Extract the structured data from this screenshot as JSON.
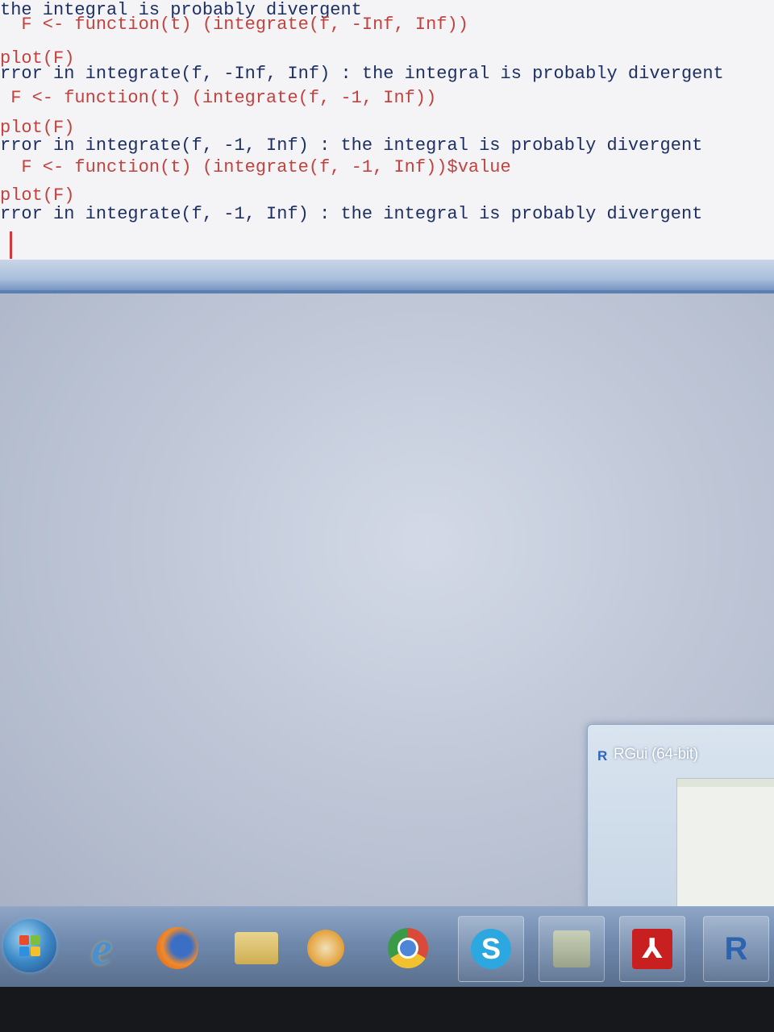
{
  "console": {
    "lines": [
      {
        "type": "output",
        "text": "the integral is probably divergent"
      },
      {
        "type": "command",
        "text": "  F <- function(t) (integrate(f, -Inf, Inf))"
      },
      {
        "type": "command",
        "text": "plot(F)"
      },
      {
        "type": "output",
        "text": "rror in integrate(f, -Inf, Inf) : the integral is probably divergent"
      },
      {
        "type": "command",
        "text": " F <- function(t) (integrate(f, -1, Inf))"
      },
      {
        "type": "command",
        "text": "plot(F)"
      },
      {
        "type": "output",
        "text": "rror in integrate(f, -1, Inf) : the integral is probably divergent"
      },
      {
        "type": "command",
        "text": "  F <- function(t) (integrate(f, -1, Inf))$value"
      },
      {
        "type": "command",
        "text": "plot(F)"
      },
      {
        "type": "output",
        "text": "rror in integrate(f, -1, Inf) : the integral is probably divergent"
      }
    ]
  },
  "taskbar": {
    "preview": {
      "title": "RGui (64-bit)",
      "icon_letter": "R"
    },
    "items": [
      {
        "name": "start-button",
        "icon": "windows-flag-icon"
      },
      {
        "name": "internet-explorer",
        "icon": "internet-explorer-icon",
        "glyph": "e"
      },
      {
        "name": "firefox",
        "icon": "firefox-icon"
      },
      {
        "name": "file-explorer",
        "icon": "folder-icon"
      },
      {
        "name": "media-player",
        "icon": "media-player-icon"
      },
      {
        "name": "chrome",
        "icon": "chrome-icon"
      },
      {
        "name": "skype",
        "icon": "skype-icon",
        "glyph": "S"
      },
      {
        "name": "app",
        "icon": "app-icon"
      },
      {
        "name": "acrobat",
        "icon": "acrobat-icon",
        "glyph": "⅄"
      },
      {
        "name": "rgui",
        "icon": "r-icon",
        "glyph": "R"
      }
    ]
  },
  "colors": {
    "command": "#c2423e",
    "output": "#1d2f63",
    "cursor": "#d8373a"
  }
}
